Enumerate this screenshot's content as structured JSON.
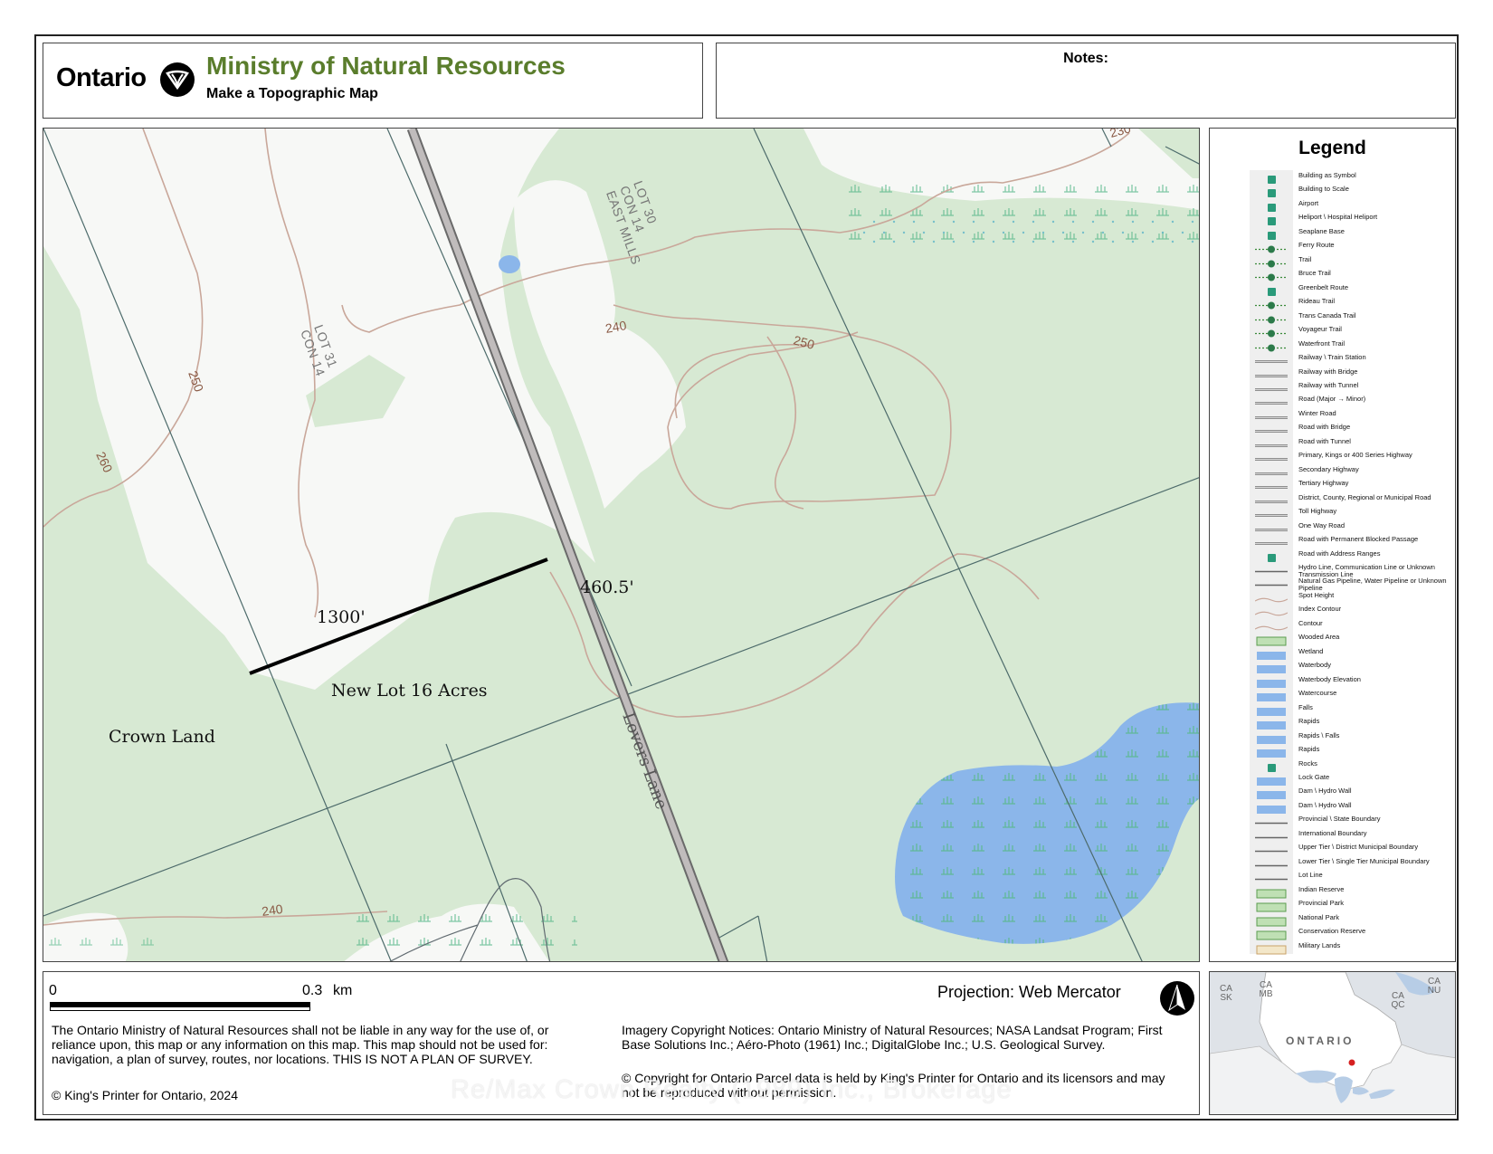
{
  "header": {
    "brand_word": "Ontario",
    "ministry_title": "Ministry of Natural Resources",
    "subtitle": "Make a Topographic Map",
    "notes_label": "Notes:"
  },
  "map": {
    "annotations": {
      "line_long": "1300'",
      "line_short": "460.5'",
      "new_lot": "New Lot 16 Acres",
      "crown_land": "Crown Land",
      "road_name": "Lovers Lane"
    },
    "lot_labels": [
      {
        "line1": "LOT 30",
        "line2": "CON 14",
        "line3": "EAST MILLS"
      },
      {
        "line1": "LOT 31",
        "line2": "CON 14",
        "line3": ""
      }
    ],
    "contour_labels": [
      "230",
      "240",
      "250",
      "250",
      "260",
      "240"
    ],
    "colors": {
      "wooded": "#d7e9d3",
      "clear": "#f7f8f6",
      "water": "#8bb6ea",
      "contour": "#c9a79a",
      "road_fill": "#c0bcbc",
      "road_edge": "#6a6a6a",
      "lot_line": "#4d6b6b"
    }
  },
  "legend": {
    "title": "Legend",
    "items": [
      {
        "label": "Building as Symbol",
        "icon": "dot-icon"
      },
      {
        "label": "Building to Scale",
        "icon": "building-icon"
      },
      {
        "label": "Airport",
        "icon": "airport-icon"
      },
      {
        "label": "Heliport \\ Hospital Heliport",
        "icon": "heliport-icon"
      },
      {
        "label": "Seaplane Base",
        "icon": "seaplane-icon"
      },
      {
        "label": "Ferry Route",
        "icon": "ferry-icon"
      },
      {
        "label": "Trail",
        "icon": "trail-icon"
      },
      {
        "label": "Bruce Trail",
        "icon": "bruce-trail-icon"
      },
      {
        "label": "Greenbelt Route",
        "icon": "greenbelt-icon"
      },
      {
        "label": "Rideau Trail",
        "icon": "rideau-trail-icon"
      },
      {
        "label": "Trans Canada Trail",
        "icon": "trans-canada-trail-icon"
      },
      {
        "label": "Voyageur Trail",
        "icon": "voyageur-trail-icon"
      },
      {
        "label": "Waterfront Trail",
        "icon": "waterfront-trail-icon"
      },
      {
        "label": "Railway \\ Train Station",
        "icon": "railway-icon"
      },
      {
        "label": "Railway with Bridge",
        "icon": "railway-bridge-icon"
      },
      {
        "label": "Railway with Tunnel",
        "icon": "railway-tunnel-icon"
      },
      {
        "label": "Road (Major → Minor)",
        "icon": "road-major-minor-icon"
      },
      {
        "label": "Winter Road",
        "icon": "winter-road-icon"
      },
      {
        "label": "Road with Bridge",
        "icon": "road-bridge-icon"
      },
      {
        "label": "Road with Tunnel",
        "icon": "road-tunnel-icon"
      },
      {
        "label": "Primary, Kings or 400 Series Highway",
        "icon": "primary-highway-icon"
      },
      {
        "label": "Secondary Highway",
        "icon": "secondary-highway-icon"
      },
      {
        "label": "Tertiary Highway",
        "icon": "tertiary-highway-icon"
      },
      {
        "label": "District, County, Regional or Municipal Road",
        "icon": "municipal-road-icon"
      },
      {
        "label": "Toll Highway",
        "icon": "toll-highway-icon"
      },
      {
        "label": "One Way Road",
        "icon": "one-way-road-icon"
      },
      {
        "label": "Road with Permanent Blocked Passage",
        "icon": "blocked-road-icon"
      },
      {
        "label": "Road with Address Ranges",
        "icon": "address-range-icon"
      },
      {
        "label": "Hydro Line, Communication Line or Unknown Transmission Line",
        "icon": "hydro-line-icon"
      },
      {
        "label": "Natural Gas Pipeline, Water Pipeline or Unknown Pipeline",
        "icon": "pipeline-icon"
      },
      {
        "label": "Spot Height",
        "icon": "spot-height-icon"
      },
      {
        "label": "Index Contour",
        "icon": "index-contour-icon"
      },
      {
        "label": "Contour",
        "icon": "contour-icon"
      },
      {
        "label": "Wooded Area",
        "icon": "wooded-area-icon"
      },
      {
        "label": "Wetland",
        "icon": "wetland-icon"
      },
      {
        "label": "Waterbody",
        "icon": "waterbody-icon"
      },
      {
        "label": "Waterbody Elevation",
        "icon": "waterbody-elevation-icon"
      },
      {
        "label": "Watercourse",
        "icon": "watercourse-icon"
      },
      {
        "label": "Falls",
        "icon": "falls-icon"
      },
      {
        "label": "Rapids",
        "icon": "rapids-icon"
      },
      {
        "label": "Rapids \\ Falls",
        "icon": "rapids-falls-icon"
      },
      {
        "label": "Rapids",
        "icon": "rapids-icon"
      },
      {
        "label": "Rocks",
        "icon": "rocks-icon"
      },
      {
        "label": "Lock Gate",
        "icon": "lock-gate-icon"
      },
      {
        "label": "Dam \\ Hydro Wall",
        "icon": "dam-icon"
      },
      {
        "label": "Dam \\ Hydro Wall",
        "icon": "dam-icon"
      },
      {
        "label": "Provincial \\ State Boundary",
        "icon": "provincial-boundary-icon"
      },
      {
        "label": "International Boundary",
        "icon": "international-boundary-icon"
      },
      {
        "label": "Upper Tier \\ District Municipal Boundary",
        "icon": "upper-tier-boundary-icon"
      },
      {
        "label": "Lower Tier \\ Single Tier Municipal Boundary",
        "icon": "lower-tier-boundary-icon"
      },
      {
        "label": "Lot Line",
        "icon": "lot-line-icon"
      },
      {
        "label": "Indian Reserve",
        "icon": "indian-reserve-icon"
      },
      {
        "label": "Provincial Park",
        "icon": "provincial-park-icon"
      },
      {
        "label": "National Park",
        "icon": "national-park-icon"
      },
      {
        "label": "Conservation Reserve",
        "icon": "conservation-reserve-icon"
      },
      {
        "label": "Military Lands",
        "icon": "military-lands-icon"
      }
    ]
  },
  "footer": {
    "scale": {
      "zero": "0",
      "max": "0.3",
      "unit": "km"
    },
    "projection": "Projection: Web Mercator",
    "disclaimer": "The Ontario Ministry of Natural Resources shall not be liable in any way for the use of, or reliance upon, this map or any information on this map.  This map should not be used for: navigation, a plan of survey, routes, nor locations. THIS IS NOT A PLAN OF SURVEY.",
    "copyright": "© King's Printer for Ontario,  2024",
    "imagery": "Imagery Copyright Notices: Ontario Ministry of Natural Resources; NASA Landsat Program; First Base Solutions Inc.; Aéro-Photo (1961) Inc.; DigitalGlobe Inc.; U.S. Geological Survey.",
    "parcel_copyright": "© Copyright for Ontario Parcel data is held by King's Printer for Ontario and its licensors and may not be reproduced without permission.",
    "watermark": "Re/Max Crown Realty (1989) Inc., Brokerage"
  },
  "inset": {
    "labels": [
      "CA SK",
      "CA MB",
      "CA NU",
      "CA QC"
    ],
    "province": "ONTARIO",
    "location_color": "#d62020"
  }
}
